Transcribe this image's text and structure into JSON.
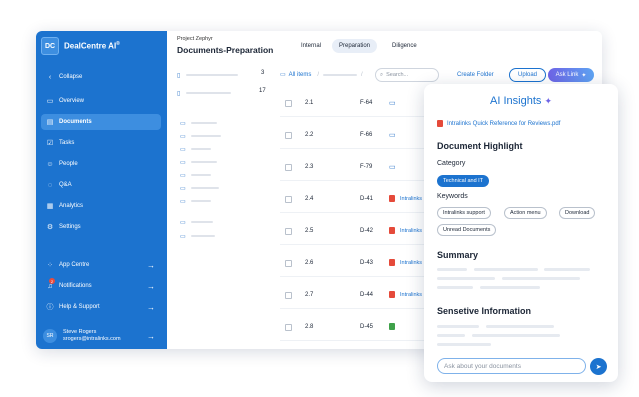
{
  "brand": {
    "logo": "DC",
    "name": "DealCentre AI",
    "trademark": "®"
  },
  "sidebar": {
    "collapse": {
      "icon": "chevron-left-icon",
      "label": "Collapse"
    },
    "items": [
      {
        "icon": "monitor-icon",
        "label": "Overview"
      },
      {
        "icon": "document-icon",
        "label": "Documents",
        "active": true
      },
      {
        "icon": "tasks-icon",
        "label": "Tasks"
      },
      {
        "icon": "people-icon",
        "label": "People"
      },
      {
        "icon": "chat-icon",
        "label": "Q&A"
      },
      {
        "icon": "analytics-icon",
        "label": "Analytics"
      },
      {
        "icon": "gear-icon",
        "label": "Settings"
      }
    ],
    "bottom_items": [
      {
        "icon": "grid-icon",
        "label": "App Centre"
      },
      {
        "icon": "bell-icon",
        "label": "Notifications",
        "badge": "2"
      },
      {
        "icon": "help-icon",
        "label": "Help & Support"
      }
    ],
    "user": {
      "initials": "SR",
      "name": "Steve Rogers",
      "email": "srogers@intralinks.com"
    }
  },
  "header": {
    "project": "Project Zephyr",
    "title": "Documents-Preparation",
    "tabs": [
      {
        "label": "Internal"
      },
      {
        "label": "Preparation",
        "active": true
      },
      {
        "label": "Diligence"
      }
    ]
  },
  "tree": {
    "count_top": "3",
    "count_second": "17"
  },
  "toolbar": {
    "all_items": "All items",
    "search_placeholder": "Search...",
    "create_folder": "Create Folder",
    "upload": "Upload",
    "ask_link": "Ask Link"
  },
  "files": [
    {
      "num": "2.1",
      "code": "F-64",
      "type": "folder",
      "name": ""
    },
    {
      "num": "2.2",
      "code": "F-66",
      "type": "folder",
      "name": ""
    },
    {
      "num": "2.3",
      "code": "F-79",
      "type": "folder",
      "name": ""
    },
    {
      "num": "2.4",
      "code": "D-41",
      "type": "pdf",
      "name": "Intralinks"
    },
    {
      "num": "2.5",
      "code": "D-42",
      "type": "pdf",
      "name": "Intralinks"
    },
    {
      "num": "2.6",
      "code": "D-43",
      "type": "pdf",
      "name": "Intralinks"
    },
    {
      "num": "2.7",
      "code": "D-44",
      "type": "pdf",
      "name": "Intralinks"
    },
    {
      "num": "2.8",
      "code": "D-45",
      "type": "xls",
      "name": ""
    }
  ],
  "ai_insights": {
    "title": "AI Insights",
    "file_name": "Intralinks Quick Reference for Reviews.pdf",
    "highlight_heading": "Document Highlight",
    "category_label": "Category",
    "category_value": "Technical and IT",
    "keywords_label": "Keywords",
    "keywords": [
      "Intralinks support",
      "Action menu",
      "Download",
      "Unread Documents"
    ],
    "summary_heading": "Summary",
    "sensitive_heading": "Sensetive Information",
    "input_placeholder": "Ask about your documents"
  },
  "colors": {
    "brand": "#1c73cf",
    "sidebar": "#1c73cf",
    "pdf": "#e54a3a",
    "xls": "#3fa14a"
  }
}
